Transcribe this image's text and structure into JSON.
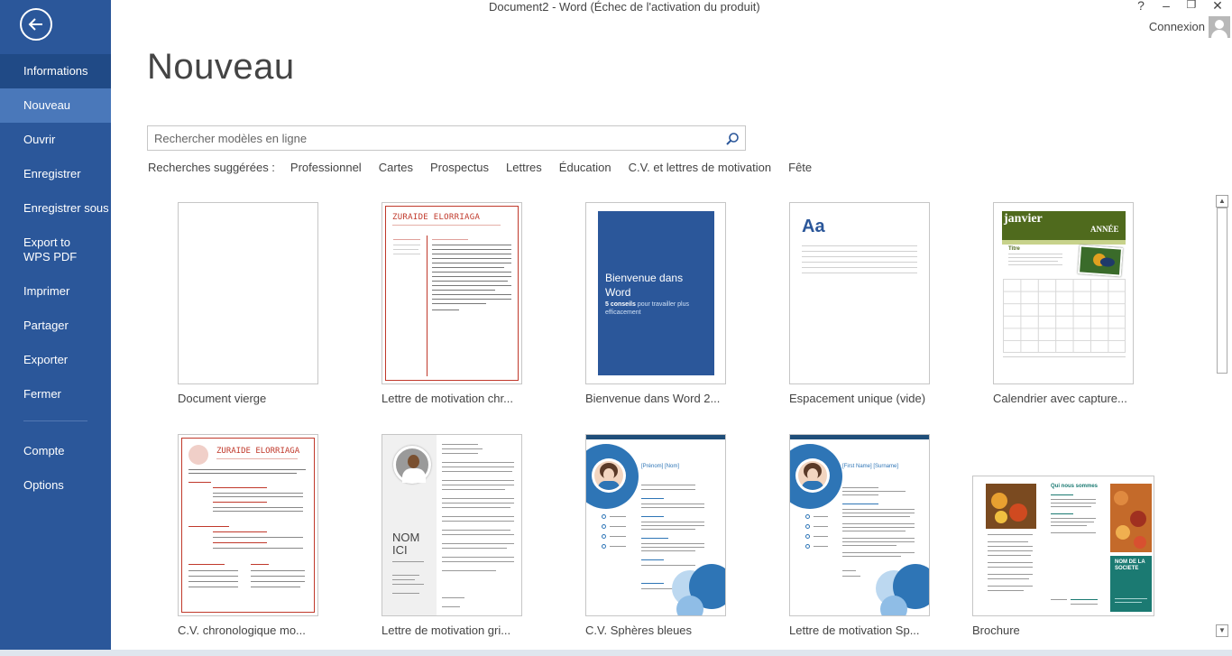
{
  "window": {
    "title": "Document2 - Word (Échec de l'activation du produit)",
    "help": "?",
    "minimize": "–",
    "restore": "❐",
    "close": "✕",
    "signin": "Connexion"
  },
  "sidebar": {
    "items": [
      {
        "label": "Informations"
      },
      {
        "label": "Nouveau"
      },
      {
        "label": "Ouvrir"
      },
      {
        "label": "Enregistrer"
      },
      {
        "label": "Enregistrer sous"
      },
      {
        "label": "Export to WPS PDF"
      },
      {
        "label": "Imprimer"
      },
      {
        "label": "Partager"
      },
      {
        "label": "Exporter"
      },
      {
        "label": "Fermer"
      },
      {
        "label": "Compte"
      },
      {
        "label": "Options"
      }
    ]
  },
  "main": {
    "heading": "Nouveau",
    "search_placeholder": "Rechercher modèles en ligne",
    "suggest_label": "Recherches suggérées :",
    "suggestions": [
      "Professionnel",
      "Cartes",
      "Prospectus",
      "Lettres",
      "Éducation",
      "C.V. et lettres de motivation",
      "Fête"
    ]
  },
  "templates": [
    {
      "label": "Document vierge"
    },
    {
      "label": "Lettre de motivation chr...",
      "thumb_name": "ZURAIDE ELORRIAGA"
    },
    {
      "label": "Bienvenue dans Word 2...",
      "thumb_title": "Bienvenue dans Word",
      "thumb_sub_bold": "5 conseils",
      "thumb_sub": "pour travailler plus efficacement"
    },
    {
      "label": "Espacement unique (vide)",
      "thumb_text": "Aa"
    },
    {
      "label": "Calendrier avec capture...",
      "thumb_month": "janvier",
      "thumb_year": "ANNÉE",
      "thumb_title": "Titre"
    },
    {
      "label": "C.V. chronologique mo...",
      "thumb_name": "ZURAIDE ELORRIAGA"
    },
    {
      "label": "Lettre de motivation gri...",
      "thumb_name": "NOM ICI"
    },
    {
      "label": "C.V. Sphères bleues",
      "thumb_name": "[Prénom] [Nom]"
    },
    {
      "label": "Lettre de motivation Sp...",
      "thumb_name": "[First Name] [Surname]"
    },
    {
      "label": "Brochure",
      "thumb_title": "Qui nous sommes",
      "thumb_panel": "NOM DE LA SOCIETE"
    }
  ],
  "colors": {
    "sidebar": "#2b579a",
    "sidebar_active": "#4a78ba",
    "word_blue": "#2b579a",
    "resume_red": "#c0392b",
    "calendar_green": "#4f6a1d",
    "sphere_blue": "#2e75b6",
    "brochure_teal": "#1b7a72"
  }
}
